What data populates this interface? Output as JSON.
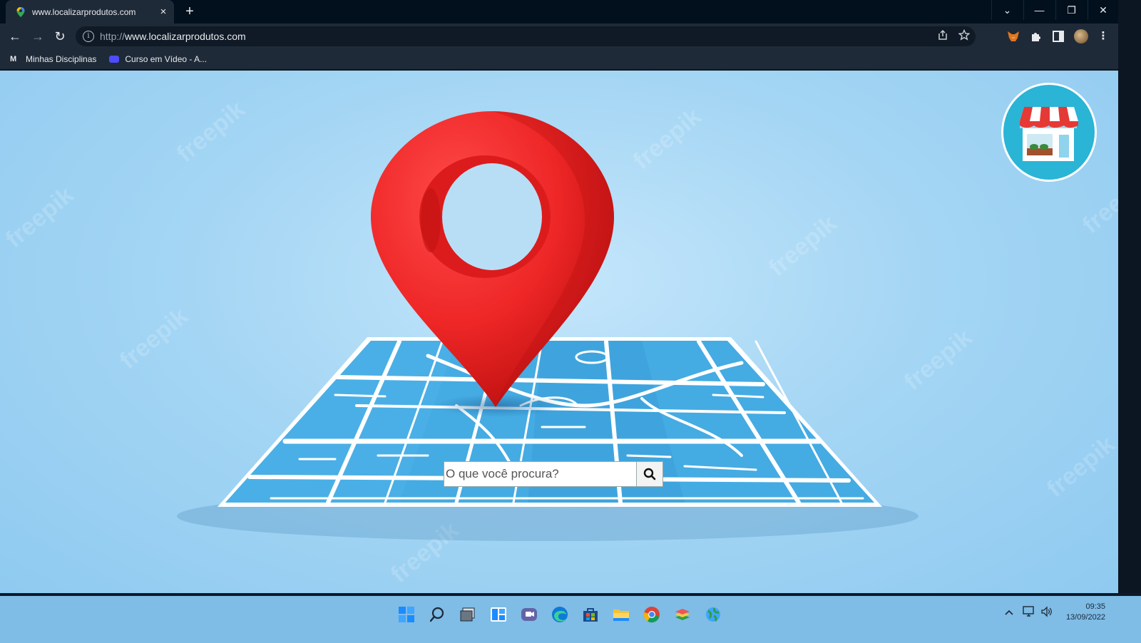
{
  "browser": {
    "tab": {
      "title": "www.localizarprodutos.com",
      "close_glyph": "×"
    },
    "new_tab_glyph": "+",
    "window_controls": {
      "tab_list": "⌄",
      "minimize": "—",
      "restore": "❐",
      "close": "✕"
    },
    "nav": {
      "back": "←",
      "forward": "→",
      "reload": "↻"
    },
    "address": {
      "scheme": "http://",
      "host": "www.localizarprodutos.com"
    },
    "bookmarks": [
      {
        "icon": "moodle-m-icon",
        "label": "Minhas Disciplinas"
      },
      {
        "icon": "curso-em-video-icon",
        "label": "Curso em Vídeo - A..."
      }
    ]
  },
  "page": {
    "search": {
      "placeholder": "O que você procura?"
    },
    "watermark": "freepik",
    "colors": {
      "pin": "#ef2a2a",
      "map": "#45abe3",
      "background": "#a5d6f4",
      "badge": "#2ab4d6"
    }
  },
  "taskbar": {
    "clock": {
      "time": "09:35",
      "date": "13/09/2022"
    },
    "apps": [
      "windows-start-icon",
      "search-icon",
      "task-view-icon",
      "widgets-icon",
      "teams-chat-icon",
      "edge-icon",
      "store-icon",
      "file-explorer-icon",
      "chrome-icon",
      "bluestacks-icon",
      "network-globe-icon"
    ]
  }
}
